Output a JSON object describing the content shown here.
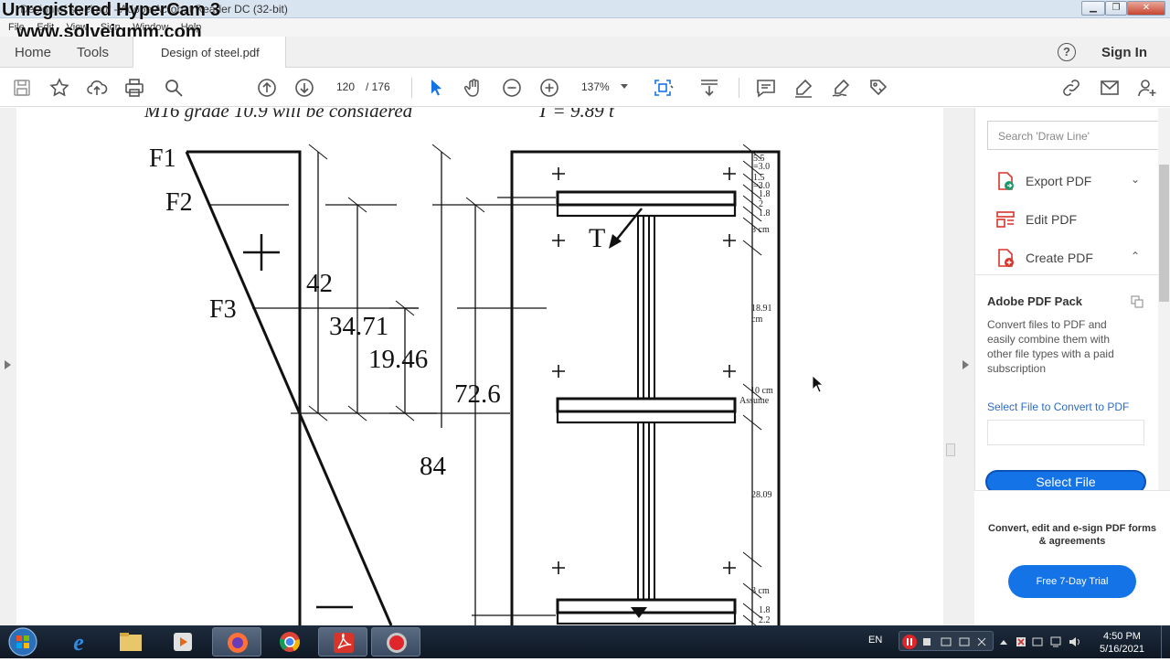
{
  "window": {
    "title": "Design of steel.pdf - Adobe Acrobat Reader DC (32-bit)",
    "watermark_line1": "Unregistered HyperCam 3",
    "watermark_line2": "www.solveigmm.com",
    "buttons": [
      "minimize",
      "maximize",
      "close"
    ]
  },
  "menubar": {
    "items": [
      "File",
      "Edit",
      "View",
      "Sign",
      "Window",
      "Help"
    ]
  },
  "tabs": {
    "home": "Home",
    "tools": "Tools",
    "document": "Design of steel.pdf",
    "sign_in": "Sign In",
    "help": "?"
  },
  "toolbar": {
    "page_current": "120",
    "page_total": "/ 176",
    "zoom": "137%",
    "icons": [
      "save-icon",
      "bookmark-star-icon",
      "upload-cloud-icon",
      "print-icon",
      "find-icon",
      "page-up-icon",
      "page-down-icon",
      "select-arrow-icon",
      "hand-icon",
      "zoom-out-icon",
      "zoom-in-icon",
      "fit-page-icon",
      "scroll-mode-icon",
      "comment-icon",
      "highlight-pen-icon",
      "sign-icon",
      "share-tag-icon",
      "link-share-icon",
      "email-icon",
      "add-user-icon"
    ]
  },
  "document": {
    "header_line": "M16 grade 10.9 will be considered",
    "header_sub": "16",
    "header_formula": "T = 9.89 t",
    "labels": {
      "f1": "F1",
      "f2": "F2",
      "f3": "F3",
      "plus": "+",
      "minus": "—",
      "d42": "42",
      "d3471": "34.71",
      "d1946": "19.46",
      "d726": "72.6",
      "d84": "84",
      "tension": "T"
    },
    "side_dims": [
      "5.5",
      "=3.0",
      "1.5",
      "=3.0",
      "1.8",
      "2",
      "1.8",
      "3 cm",
      "18.91",
      "cm",
      "10 cm",
      "Assume",
      "28.09",
      "3 cm",
      "1.8",
      "2.2"
    ]
  },
  "right_panel": {
    "search_placeholder": "Search 'Draw Line'",
    "items": [
      {
        "label": "Export PDF",
        "chevron": "⌄"
      },
      {
        "label": "Edit PDF",
        "chevron": ""
      },
      {
        "label": "Create PDF",
        "chevron": "⌃"
      }
    ],
    "pack_title": "Adobe PDF Pack",
    "pack_desc": "Convert files to PDF and easily combine them with other file types with a paid subscription",
    "select_label": "Select File to Convert to PDF",
    "select_button": "Select File",
    "convert_text": "Convert, edit and e-sign PDF forms & agreements",
    "trial_button": "Free 7-Day Trial",
    "accent": "#1473e6"
  },
  "taskbar": {
    "lang": "EN",
    "time": "4:50 PM",
    "date": "5/16/2021",
    "apps": [
      "windows-start-icon",
      "internet-explorer-icon",
      "file-explorer-icon",
      "media-player-icon",
      "firefox-icon",
      "chrome-icon",
      "acrobat-icon",
      "hypercam-icon"
    ]
  }
}
